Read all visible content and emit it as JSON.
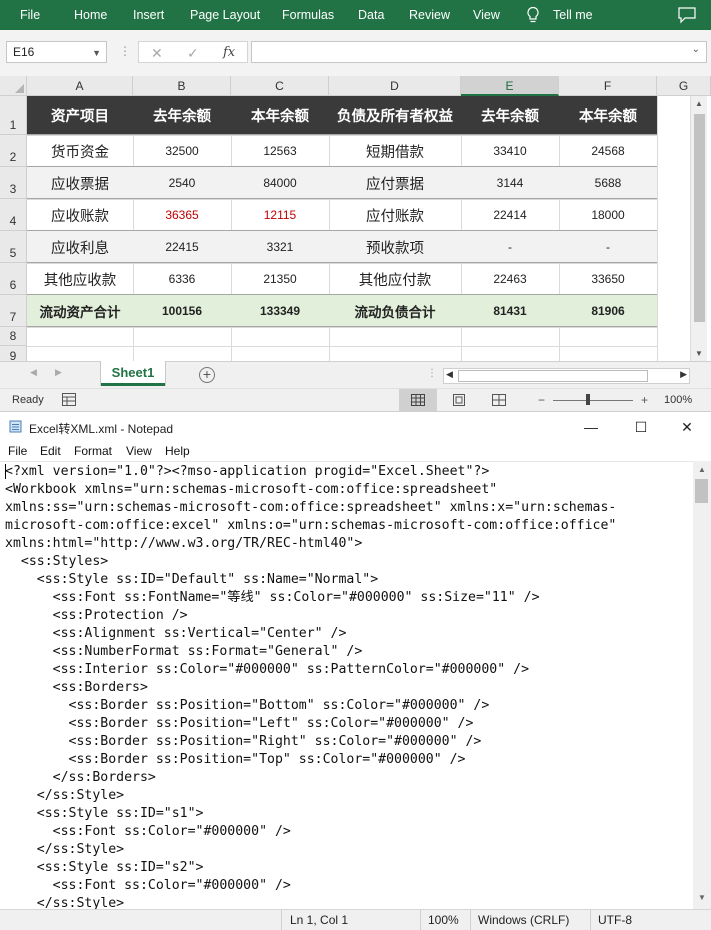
{
  "excel": {
    "menu": [
      "File",
      "Home",
      "Insert",
      "Page Layout",
      "Formulas",
      "Data",
      "Review",
      "View"
    ],
    "tell_me": "Tell me",
    "name_box": "E16",
    "formula_value": "",
    "columns": [
      "A",
      "B",
      "C",
      "D",
      "E",
      "F",
      "G"
    ],
    "selected_column": "E",
    "rows": [
      "1",
      "2",
      "3",
      "4",
      "5",
      "6",
      "7",
      "8",
      "9"
    ],
    "table": {
      "headers": [
        "资产项目",
        "去年余额",
        "本年余额",
        "负债及所有者权益",
        "去年余额",
        "本年余额"
      ],
      "rows": [
        [
          "货币资金",
          "32500",
          "12563",
          "短期借款",
          "33410",
          "24568"
        ],
        [
          "应收票据",
          "2540",
          "84000",
          "应付票据",
          "3144",
          "5688"
        ],
        [
          "应收账款",
          "36365",
          "12115",
          "应付账款",
          "22414",
          "18000"
        ],
        [
          "应收利息",
          "22415",
          "3321",
          "预收款项",
          "-",
          "-"
        ],
        [
          "其他应收款",
          "6336",
          "21350",
          "其他应付款",
          "22463",
          "33650"
        ]
      ],
      "total": [
        "流动资产合计",
        "100156",
        "133349",
        "流动负债合计",
        "81431",
        "81906"
      ],
      "header_bg": "#3a3a3a",
      "total_bg": "#e2efda",
      "red_text": "#c00000"
    },
    "sheet_tab": "Sheet1",
    "status_ready": "Ready",
    "zoom": "100%",
    "accent": "#217346"
  },
  "notepad": {
    "title": "Excel转XML.xml - Notepad",
    "menu": [
      "File",
      "Edit",
      "Format",
      "View",
      "Help"
    ],
    "lines": [
      "<?xml version=\"1.0\"?><?mso-application progid=\"Excel.Sheet\"?>",
      "<Workbook xmlns=\"urn:schemas-microsoft-com:office:spreadsheet\"",
      "xmlns:ss=\"urn:schemas-microsoft-com:office:spreadsheet\" xmlns:x=\"urn:schemas-",
      "microsoft-com:office:excel\" xmlns:o=\"urn:schemas-microsoft-com:office:office\"",
      "xmlns:html=\"http://www.w3.org/TR/REC-html40\">",
      "  <ss:Styles>",
      "    <ss:Style ss:ID=\"Default\" ss:Name=\"Normal\">",
      "      <ss:Font ss:FontName=\"等线\" ss:Color=\"#000000\" ss:Size=\"11\" />",
      "      <ss:Protection />",
      "      <ss:Alignment ss:Vertical=\"Center\" />",
      "      <ss:NumberFormat ss:Format=\"General\" />",
      "      <ss:Interior ss:Color=\"#000000\" ss:PatternColor=\"#000000\" />",
      "      <ss:Borders>",
      "        <ss:Border ss:Position=\"Bottom\" ss:Color=\"#000000\" />",
      "        <ss:Border ss:Position=\"Left\" ss:Color=\"#000000\" />",
      "        <ss:Border ss:Position=\"Right\" ss:Color=\"#000000\" />",
      "        <ss:Border ss:Position=\"Top\" ss:Color=\"#000000\" />",
      "      </ss:Borders>",
      "    </ss:Style>",
      "    <ss:Style ss:ID=\"s1\">",
      "      <ss:Font ss:Color=\"#000000\" />",
      "    </ss:Style>",
      "    <ss:Style ss:ID=\"s2\">",
      "      <ss:Font ss:Color=\"#000000\" />",
      "    </ss:Style>"
    ],
    "status": {
      "position": "Ln 1, Col 1",
      "zoom": "100%",
      "line_ending": "Windows (CRLF)",
      "encoding": "UTF-8"
    }
  }
}
